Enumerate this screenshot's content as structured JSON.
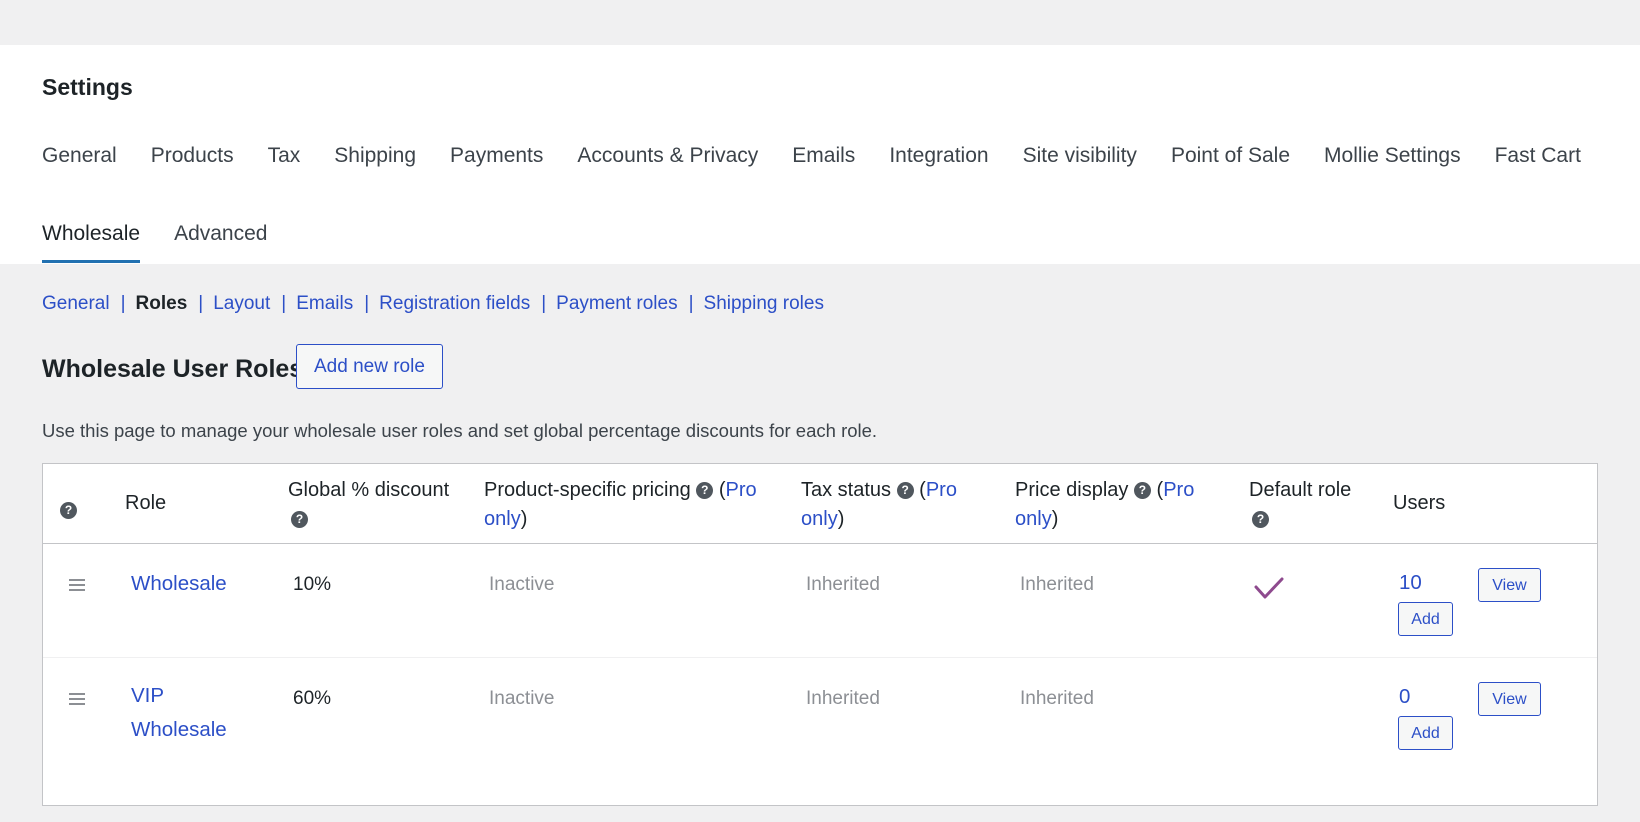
{
  "header": {
    "title": "Settings",
    "main_tabs": [
      "General",
      "Products",
      "Tax",
      "Shipping",
      "Payments",
      "Accounts & Privacy",
      "Emails",
      "Integration",
      "Site visibility",
      "Point of Sale",
      "Mollie Settings",
      "Fast Cart"
    ],
    "sub_tabs": [
      {
        "label": "Wholesale",
        "active": true
      },
      {
        "label": "Advanced",
        "active": false
      }
    ]
  },
  "subnav": {
    "items": [
      "General",
      "Roles",
      "Layout",
      "Emails",
      "Registration fields",
      "Payment roles",
      "Shipping roles"
    ],
    "current": "Roles",
    "separator": "|"
  },
  "section": {
    "title": "Wholesale User Roles",
    "add_button": "Add new role",
    "description": "Use this page to manage your wholesale user roles and set global percentage discounts for each role."
  },
  "table": {
    "help_glyph": "?",
    "columns": {
      "role": "Role",
      "discount": "Global % discount",
      "pricing": "Product-specific pricing",
      "tax": "Tax status",
      "price_display": "Price display",
      "default_role": "Default role",
      "users": "Users",
      "pro_open": "(",
      "pro_link_1": "Pro",
      "pro_link_2": "only",
      "pro_close": ")"
    },
    "rows": [
      {
        "role_line1": "Wholesale",
        "role_line2": "",
        "discount": "10%",
        "pricing": "Inactive",
        "tax": "Inherited",
        "price_display": "Inherited",
        "is_default": true,
        "users": "10",
        "view_label": "View",
        "add_label": "Add"
      },
      {
        "role_line1": "VIP",
        "role_line2": "Wholesale",
        "discount": "60%",
        "pricing": "Inactive",
        "tax": "Inherited",
        "price_display": "Inherited",
        "is_default": false,
        "users": "0",
        "view_label": "View",
        "add_label": "Add"
      }
    ]
  },
  "colors": {
    "link": "#2c4fc7",
    "active_tab_underline": "#2271b1",
    "checkmark": "#8e4a8e",
    "muted_text": "#8c8f94"
  },
  "icons": {
    "help": "question-circle-icon",
    "drag": "drag-handle-icon",
    "default": "checkmark-icon"
  }
}
